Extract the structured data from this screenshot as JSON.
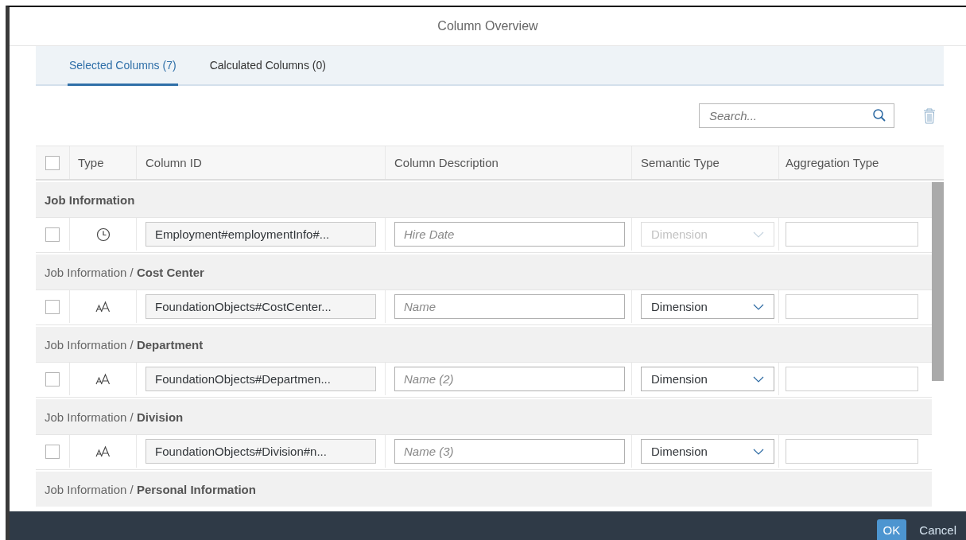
{
  "dialog": {
    "title": "Column Overview"
  },
  "tabs": [
    {
      "label": "Selected Columns (7)",
      "selected": true
    },
    {
      "label": "Calculated Columns (0)",
      "selected": false
    }
  ],
  "search": {
    "placeholder": "Search..."
  },
  "table": {
    "select_all": {
      "checked": false
    },
    "columns": [
      "Type",
      "Column ID",
      "Column Description",
      "Semantic Type",
      "Aggregation Type"
    ],
    "rows": [
      {
        "kind": "group",
        "label": "Job Information",
        "top_level": true
      },
      {
        "kind": "item",
        "checked": false,
        "type_cell": {
          "kind": "date"
        },
        "column_id": "Employment#employmentInfo#...",
        "description_placeholder": "Hire Date",
        "semantic_type": "Dimension",
        "semantic_disabled": true
      },
      {
        "kind": "group",
        "label": "Job Information / **Cost Center**",
        "top_level": false
      },
      {
        "kind": "item",
        "checked": false,
        "type_cell": {
          "kind": "text"
        },
        "column_id": "FoundationObjects#CostCenter...",
        "description_placeholder": "Name",
        "semantic_type": "Dimension",
        "semantic_disabled": false
      },
      {
        "kind": "group",
        "label": "Job Information / **Department**",
        "top_level": false
      },
      {
        "kind": "item",
        "checked": false,
        "type_cell": {
          "kind": "text"
        },
        "column_id": "FoundationObjects#Departmen...",
        "description_placeholder": "Name (2)",
        "semantic_type": "Dimension",
        "semantic_disabled": false
      },
      {
        "kind": "group",
        "label": "Job Information / **Division**",
        "top_level": false
      },
      {
        "kind": "item",
        "checked": false,
        "type_cell": {
          "kind": "text"
        },
        "column_id": "FoundationObjects#Division#n...",
        "description_placeholder": "Name (3)",
        "semantic_type": "Dimension",
        "semantic_disabled": false
      },
      {
        "kind": "group",
        "label": "Job Information / **Personal Information**",
        "top_level": false
      }
    ]
  },
  "footer": {
    "buttons": [
      {
        "label": "OK",
        "kind": "primary"
      },
      {
        "label": "Cancel",
        "kind": "plain"
      }
    ]
  }
}
